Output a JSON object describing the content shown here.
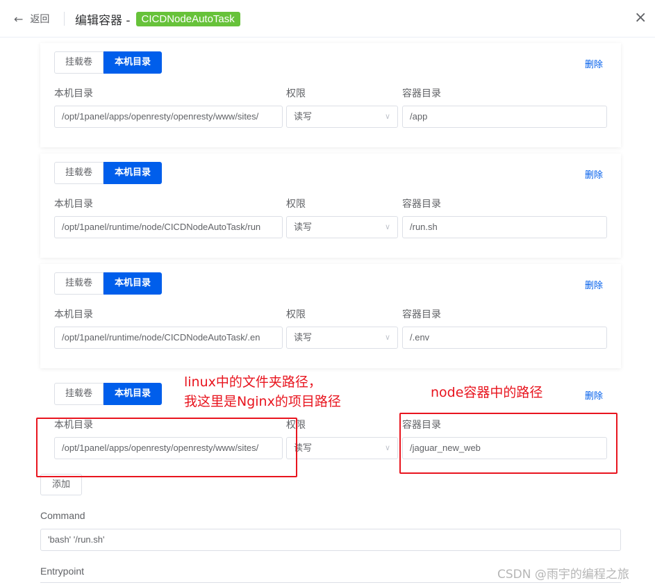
{
  "header": {
    "back_label": "返回",
    "title": "编辑容器 -",
    "tag": "CICDNodeAutoTask",
    "close_symbol": "×"
  },
  "mounts": [
    {
      "type_options": [
        "挂载卷",
        "本机目录"
      ],
      "selected_type": "本机目录",
      "delete_label": "删除",
      "host_label": "本机目录",
      "host_value": "/opt/1panel/apps/openresty/openresty/www/sites/",
      "perm_label": "权限",
      "perm_value": "读写",
      "container_label": "容器目录",
      "container_value": "/app"
    },
    {
      "type_options": [
        "挂载卷",
        "本机目录"
      ],
      "selected_type": "本机目录",
      "delete_label": "删除",
      "host_label": "本机目录",
      "host_value": "/opt/1panel/runtime/node/CICDNodeAutoTask/run",
      "perm_label": "权限",
      "perm_value": "读写",
      "container_label": "容器目录",
      "container_value": "/run.sh"
    },
    {
      "type_options": [
        "挂载卷",
        "本机目录"
      ],
      "selected_type": "本机目录",
      "delete_label": "删除",
      "host_label": "本机目录",
      "host_value": "/opt/1panel/runtime/node/CICDNodeAutoTask/.en",
      "perm_label": "权限",
      "perm_value": "读写",
      "container_label": "容器目录",
      "container_value": "/.env"
    },
    {
      "type_options": [
        "挂载卷",
        "本机目录"
      ],
      "selected_type": "本机目录",
      "delete_label": "删除",
      "host_label": "本机目录",
      "host_value": "/opt/1panel/apps/openresty/openresty/www/sites/",
      "perm_label": "权限",
      "perm_value": "读写",
      "container_label": "容器目录",
      "container_value": "/jaguar_new_web"
    }
  ],
  "add_label": "添加",
  "command": {
    "label": "Command",
    "value": "'bash' '/run.sh'"
  },
  "entrypoint": {
    "label": "Entrypoint"
  },
  "annotations": {
    "left_line1": "linux中的文件夹路径，",
    "left_line2": "我这里是Nginx的项目路径",
    "right": "node容器中的路径"
  },
  "watermark": "CSDN @雨宇的编程之旅",
  "colors": {
    "primary": "#005eeb",
    "tag": "#67c23a",
    "annotation": "#e8141e"
  },
  "icons": {
    "back": "left-arrow-icon",
    "close": "close-icon",
    "select": "chevron-down-icon"
  }
}
